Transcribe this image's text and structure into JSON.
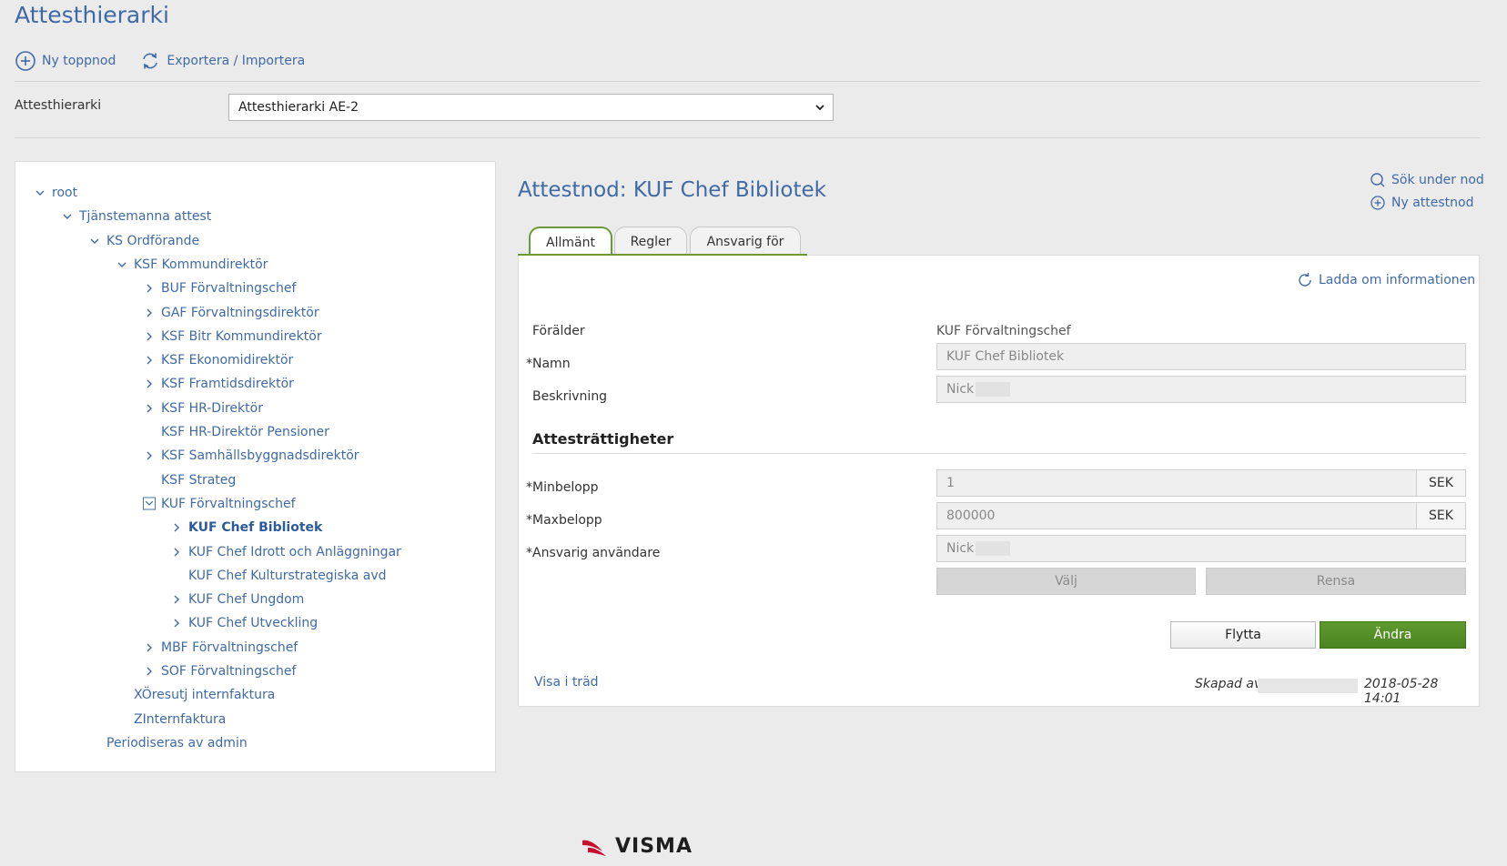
{
  "page": {
    "title": "Attesthierarki"
  },
  "toolbar": {
    "new_top_node": "Ny toppnod",
    "export_import": "Exportera / Importera"
  },
  "selector": {
    "label": "Attesthierarki",
    "value": "Attesthierarki AE-2"
  },
  "tree": [
    {
      "label": "root",
      "toggle": "expanded",
      "depth": 0
    },
    {
      "label": "Tjänstemanna attest",
      "toggle": "expanded",
      "depth": 1
    },
    {
      "label": "KS Ordförande",
      "toggle": "expanded",
      "depth": 2
    },
    {
      "label": "KSF Kommundirektör",
      "toggle": "expanded",
      "depth": 3
    },
    {
      "label": "BUF Förvaltningschef",
      "toggle": "collapsed",
      "depth": 4
    },
    {
      "label": "GAF Förvaltningsdirektör",
      "toggle": "collapsed",
      "depth": 4
    },
    {
      "label": "KSF Bitr Kommundirektör",
      "toggle": "collapsed",
      "depth": 4
    },
    {
      "label": "KSF Ekonomidirektör",
      "toggle": "collapsed",
      "depth": 4
    },
    {
      "label": "KSF Framtidsdirektör",
      "toggle": "collapsed",
      "depth": 4
    },
    {
      "label": "KSF HR-Direktör",
      "toggle": "collapsed",
      "depth": 4
    },
    {
      "label": "KSF HR-Direktör Pensioner",
      "toggle": "none",
      "depth": 4
    },
    {
      "label": "KSF Samhällsbyggnadsdirektör",
      "toggle": "collapsed",
      "depth": 4
    },
    {
      "label": "KSF Strateg",
      "toggle": "none",
      "depth": 4
    },
    {
      "label": "KUF Förvaltningschef",
      "toggle": "expanded-box",
      "depth": 4
    },
    {
      "label": "KUF Chef Bibliotek",
      "toggle": "collapsed",
      "depth": 5,
      "active": true
    },
    {
      "label": "KUF Chef Idrott och Anläggningar",
      "toggle": "collapsed",
      "depth": 5
    },
    {
      "label": "KUF Chef Kulturstrategiska avd",
      "toggle": "none",
      "depth": 5
    },
    {
      "label": "KUF Chef Ungdom",
      "toggle": "collapsed",
      "depth": 5
    },
    {
      "label": "KUF Chef Utveckling",
      "toggle": "collapsed",
      "depth": 5
    },
    {
      "label": "MBF Förvaltningschef",
      "toggle": "collapsed",
      "depth": 4
    },
    {
      "label": "SOF Förvaltningschef",
      "toggle": "collapsed",
      "depth": 4
    },
    {
      "label": "XÖresutj internfaktura",
      "toggle": "none",
      "depth": 3
    },
    {
      "label": "ZInternfaktura",
      "toggle": "none",
      "depth": 3
    },
    {
      "label": "Periodiseras av admin",
      "toggle": "none",
      "depth": 2
    }
  ],
  "detail": {
    "title": "Attestnod: KUF Chef Bibliotek",
    "search_under_node": "Sök under nod",
    "new_attest_node": "Ny attestnod",
    "tabs": [
      "Allmänt",
      "Regler",
      "Ansvarig för"
    ],
    "reload": "Ladda om informationen",
    "parent_label": "Förälder",
    "parent_value": "KUF Förvaltningschef",
    "name_label": "*Namn",
    "name_value": "KUF Chef Bibliotek",
    "description_label": "Beskrivning",
    "description_value": "Nick",
    "rights_title": "Attesträttigheter",
    "min_label": "*Minbelopp",
    "min_value": "1",
    "max_label": "*Maxbelopp",
    "max_value": "800000",
    "currency": "SEK",
    "responsible_label": "*Ansvarig användare",
    "responsible_value": "Nick",
    "choose_button": "Välj",
    "clear_button": "Rensa",
    "move_button": "Flytta",
    "edit_button": "Ändra",
    "show_in_tree": "Visa i träd",
    "created_by_label": "Skapad av",
    "created_date": "2018-05-28 14:01"
  },
  "brand": {
    "name": "VISMA",
    "color": "#c8102e"
  },
  "colors": {
    "link": "#3f6aa6",
    "accent": "#6c9a3a",
    "primary_button": "#4a8420"
  }
}
